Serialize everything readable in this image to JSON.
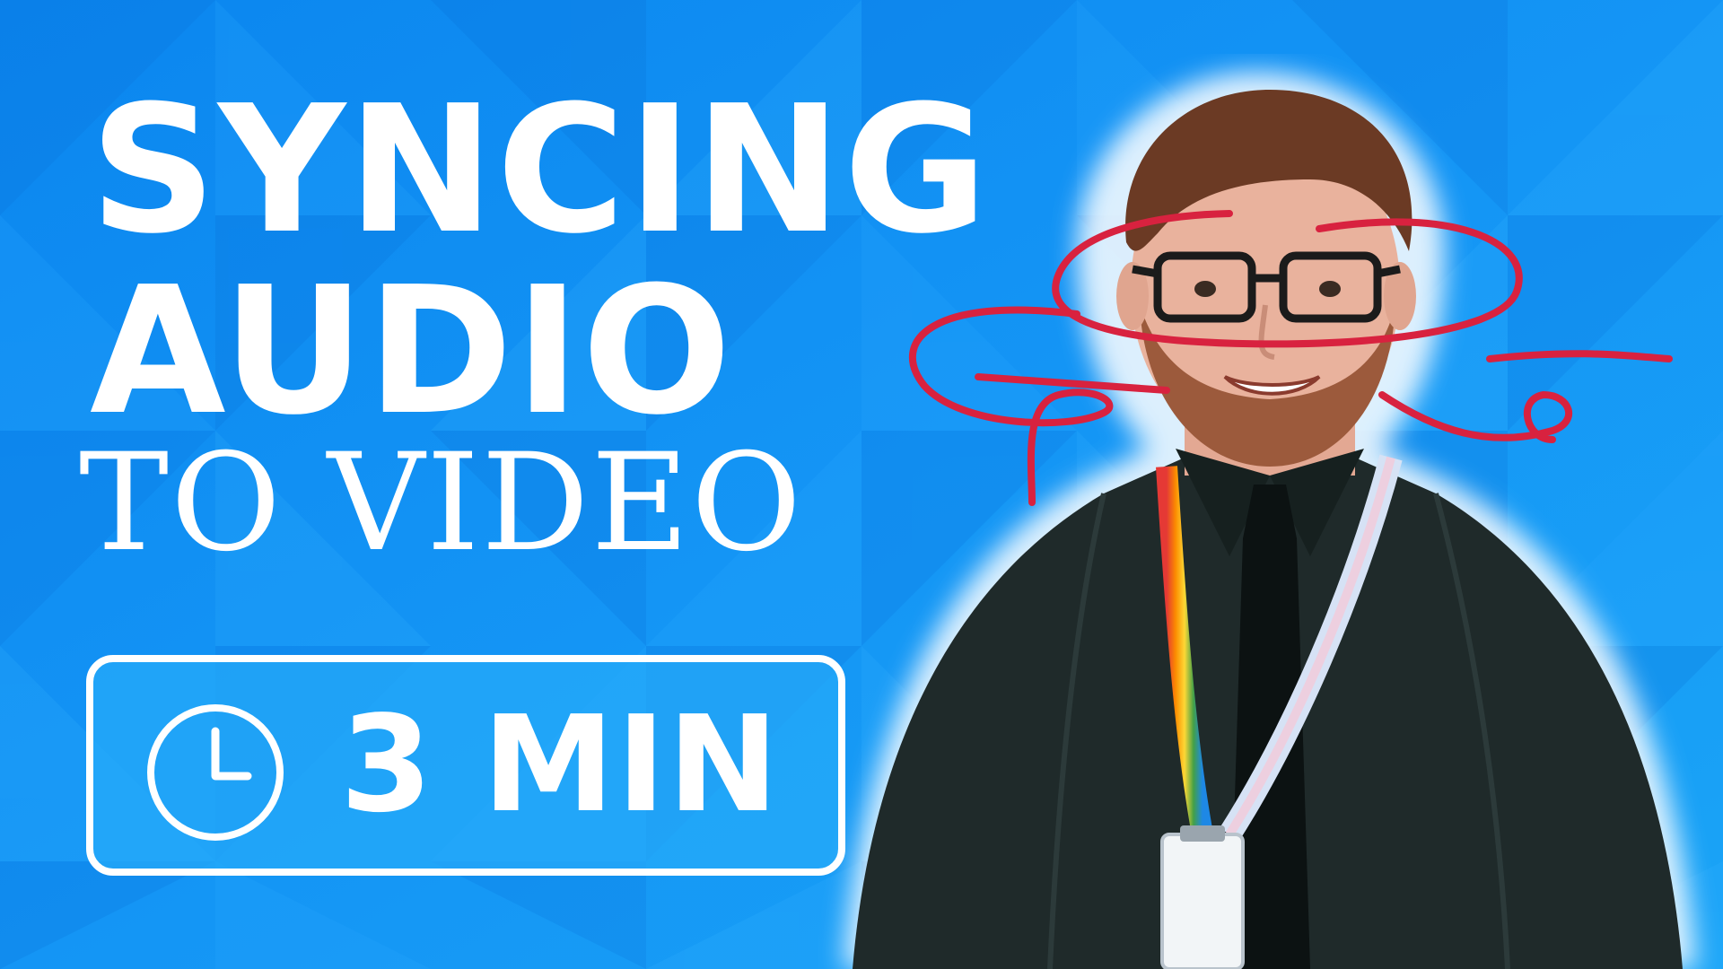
{
  "thumbnail": {
    "title_line_1": "SYNCING",
    "title_line_2": "AUDIO",
    "title_line_3": "TO VIDEO",
    "duration_label": "3 MIN"
  },
  "icons": {
    "duration_icon": "clock-icon"
  },
  "colors": {
    "background": "#1493f4",
    "text": "#ffffff",
    "badge_fill": "#26aafa",
    "scribble": "#d8223f",
    "shirt": "#1f2a2a"
  }
}
